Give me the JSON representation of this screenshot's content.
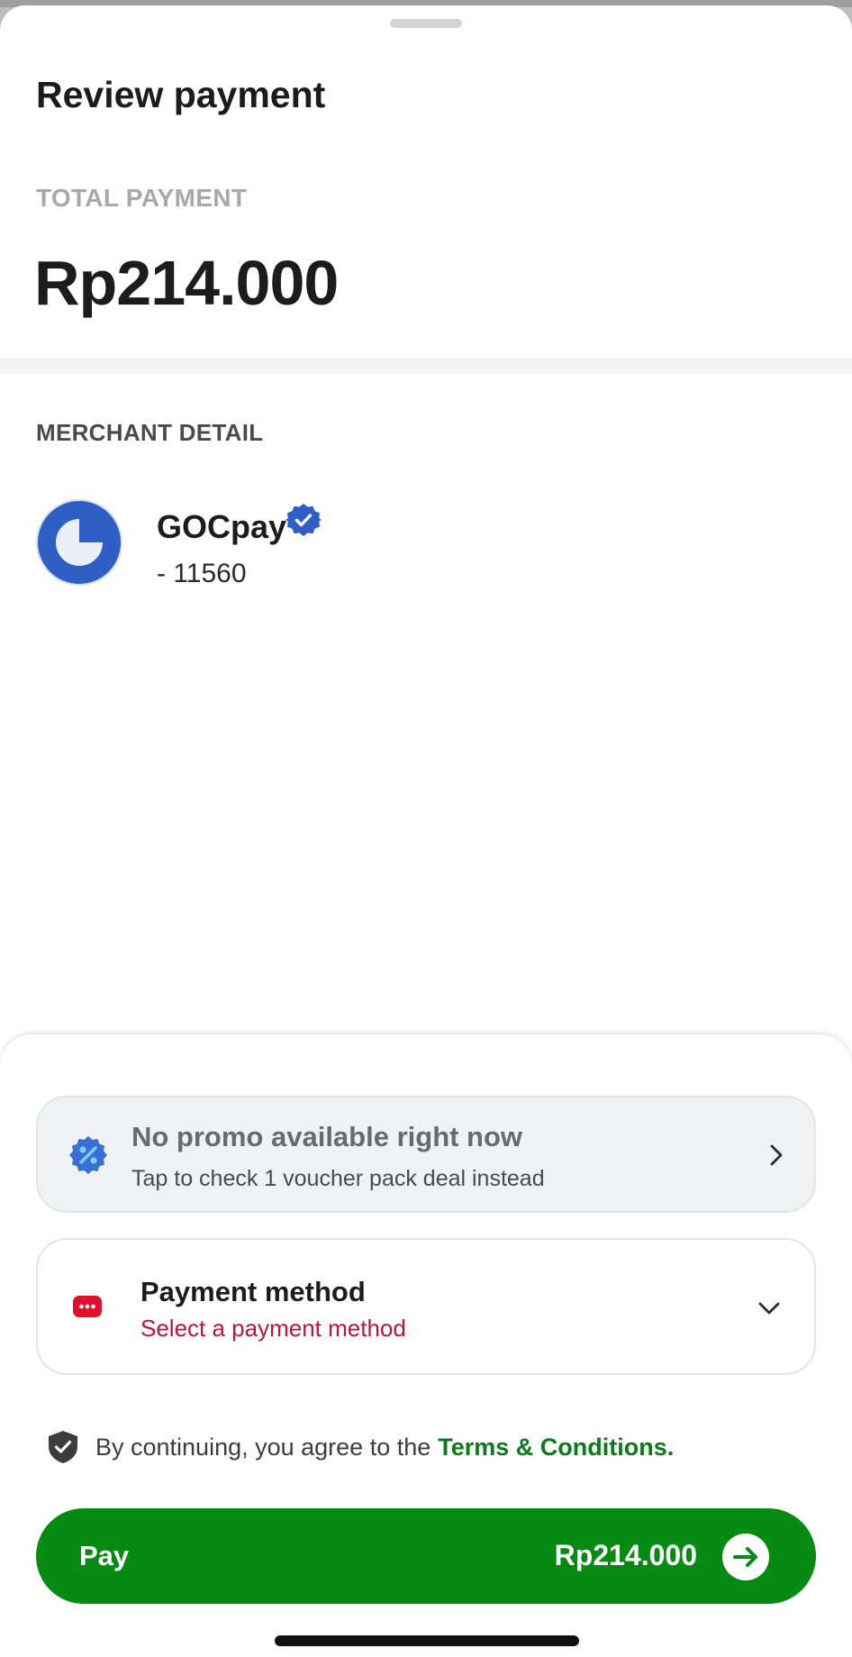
{
  "sheet": {
    "title": "Review payment",
    "total_label": "TOTAL PAYMENT",
    "total_amount": "Rp214.000"
  },
  "merchant": {
    "section_label": "MERCHANT DETAIL",
    "name": "GOCpay",
    "id": "- 11560",
    "verified": true,
    "icons": {
      "logo": "gocpay-logo",
      "badge": "verified-badge-icon"
    }
  },
  "promo": {
    "title": "No promo available right now",
    "subtitle": "Tap to check 1 voucher pack deal instead",
    "icon": "promo-percent-icon"
  },
  "payment_method": {
    "title": "Payment method",
    "subtitle": "Select a payment method",
    "icon": "payment-card-icon"
  },
  "terms": {
    "text": "By continuing, you agree to the",
    "link": "Terms & Conditions."
  },
  "pay_button": {
    "label": "Pay",
    "amount": "Rp214.000"
  },
  "colors": {
    "accent_green": "#058a12",
    "link_green": "#0b7a1a",
    "brand_blue": "#2f5fc4",
    "error_red": "#c0133a",
    "payment_icon_red": "#e0102d"
  }
}
